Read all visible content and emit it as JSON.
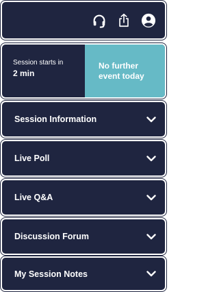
{
  "header": {
    "icons": [
      "headset-icon",
      "share-icon",
      "account-icon"
    ]
  },
  "session": {
    "starts_label": "Session starts in",
    "starts_value": "2 min",
    "next_event_line1": "No further",
    "next_event_line2": "event today"
  },
  "sections": [
    {
      "label": "Session Information"
    },
    {
      "label": "Live Poll"
    },
    {
      "label": "Live Q&A"
    },
    {
      "label": "Discussion Forum"
    },
    {
      "label": "My Session Notes"
    }
  ],
  "colors": {
    "panel": "#1f2540",
    "accent": "#66bac6",
    "text": "#ffffff"
  }
}
